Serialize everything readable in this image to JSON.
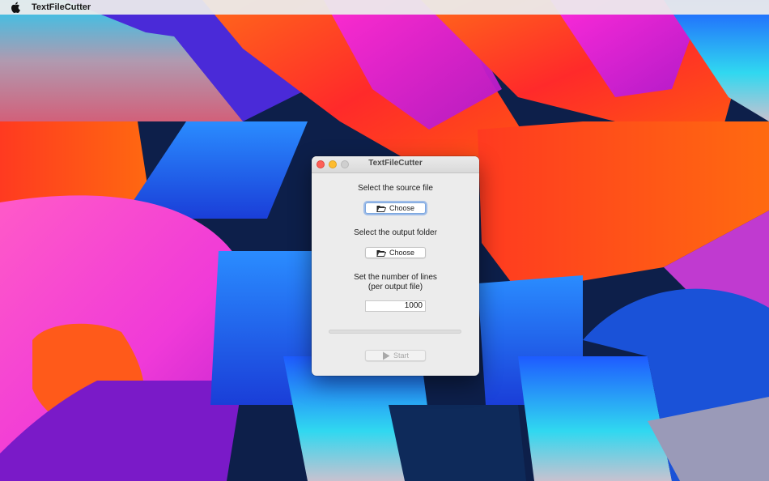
{
  "menubar": {
    "apple_icon": "apple-logo-icon",
    "app_name": "TextFileCutter"
  },
  "window": {
    "title": "TextFileCutter",
    "source_label": "Select the source file",
    "source_button_label": "Choose",
    "output_label": "Select the output folder",
    "output_button_label": "Choose",
    "lines_label_line1": "Set the number of lines",
    "lines_label_line2": "(per output file)",
    "lines_value": "1000",
    "progress": 0,
    "start_label": "Start"
  },
  "icons": {
    "choose": "folder-icon",
    "start": "play-icon"
  },
  "colors": {
    "close": "#fe5f57",
    "minimize": "#febc2e",
    "zoom": "#cfcfcf",
    "focus_ring": "#6096e4"
  }
}
